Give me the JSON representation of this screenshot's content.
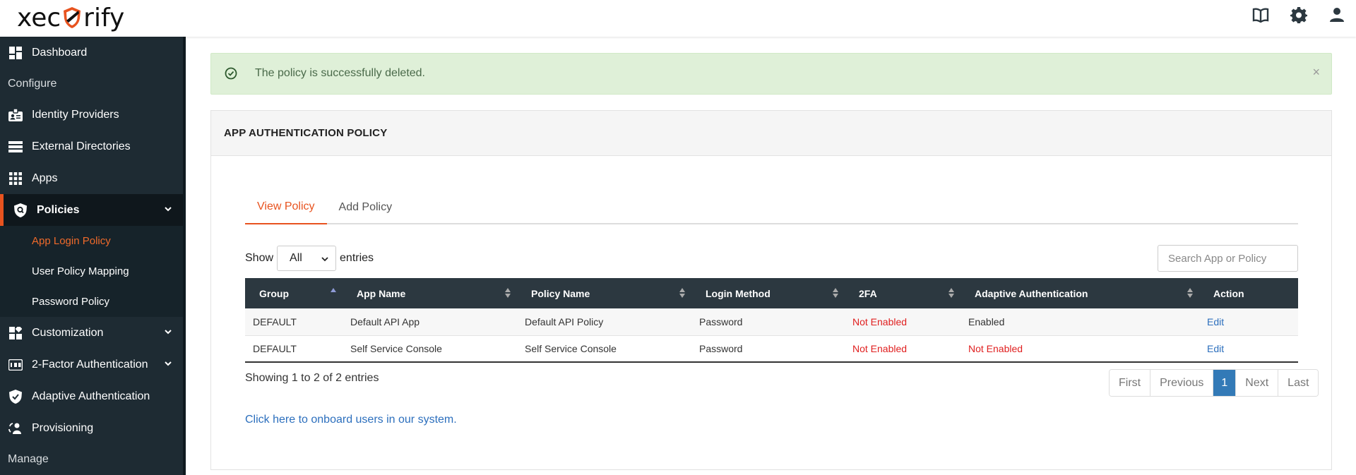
{
  "brand": {
    "logo_left": "xec",
    "logo_right": "rify",
    "accent": "#e8531f"
  },
  "header": {
    "icons": [
      "book-icon",
      "gear-icon",
      "user-icon"
    ]
  },
  "sidebar": {
    "dashboard": "Dashboard",
    "section_configure": "Configure",
    "identity_providers": "Identity Providers",
    "external_directories": "External Directories",
    "apps": "Apps",
    "policies": "Policies",
    "sub_app_login_policy": "App Login Policy",
    "sub_user_policy_mapping": "User Policy Mapping",
    "sub_password_policy": "Password Policy",
    "customization": "Customization",
    "two_factor": "2-Factor Authentication",
    "adaptive": "Adaptive Authentication",
    "provisioning": "Provisioning",
    "section_manage": "Manage"
  },
  "alert": {
    "message": "The policy is successfully deleted.",
    "close": "×"
  },
  "panel": {
    "title": "APP AUTHENTICATION POLICY"
  },
  "tabs": {
    "view": "View Policy",
    "add": "Add Policy"
  },
  "controls": {
    "show": "Show",
    "entries_value": "All",
    "entries": "entries",
    "search_placeholder": "Search App or Policy"
  },
  "table": {
    "headers": [
      "Group",
      "App Name",
      "Policy Name",
      "Login Method",
      "2FA",
      "Adaptive Authentication",
      "Action"
    ],
    "rows": [
      [
        "DEFAULT",
        "Default API App",
        "Default API Policy",
        "Password",
        "Not Enabled",
        "Enabled",
        "Edit"
      ],
      [
        "DEFAULT",
        "Self Service Console",
        "Self Service Console",
        "Password",
        "Not Enabled",
        "Not Enabled",
        "Edit"
      ]
    ]
  },
  "info": "Showing 1 to 2 of 2 entries",
  "pagination": {
    "first": "First",
    "previous": "Previous",
    "page": "1",
    "next": "Next",
    "last": "Last"
  },
  "onboard_link": "Click here to onboard users in our system."
}
